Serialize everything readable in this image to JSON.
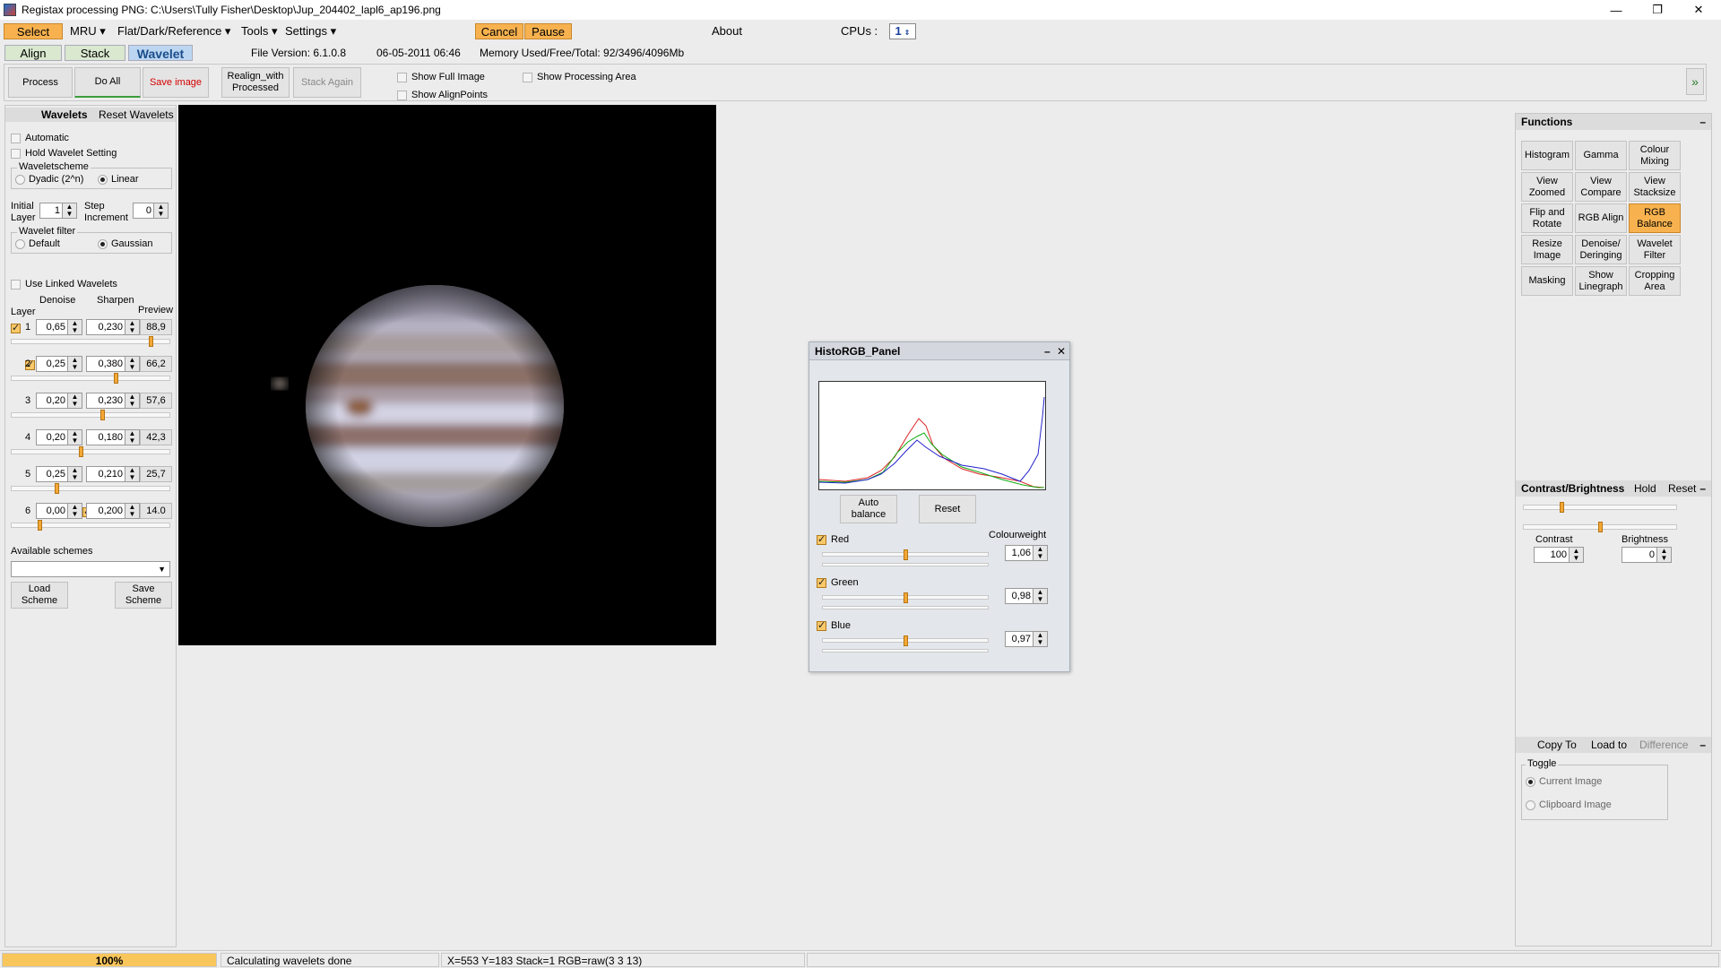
{
  "window": {
    "title": "Registax processing PNG: C:\\Users\\Tully Fisher\\Desktop\\Jup_204402_lapl6_ap196.png",
    "minimize": "—",
    "maximize": "❐",
    "close": "✕"
  },
  "menu": {
    "select": "Select",
    "mru": "MRU ▾",
    "flat": "Flat/Dark/Reference ▾",
    "tools": "Tools ▾",
    "settings": "Settings ▾",
    "cancel": "Cancel",
    "pause": "Pause",
    "about": "About",
    "cpus_label": "CPUs :",
    "cpus_value": "1"
  },
  "tabs": {
    "align": "Align",
    "stack": "Stack",
    "wavelet": "Wavelet"
  },
  "info": {
    "file_version": "File Version: 6.1.0.8",
    "date": "06-05-2011 06:46",
    "memory": "Memory Used/Free/Total: 92/3496/4096Mb"
  },
  "toolbar": {
    "process": "Process",
    "do_all": "Do All",
    "save_image": "Save image",
    "realign": "Realign_with Processed",
    "stack_again": "Stack Again",
    "show_full_image": "Show Full Image",
    "show_alignpoints": "Show AlignPoints",
    "show_processing_area": "Show Processing Area",
    "expand": "»"
  },
  "wavelets": {
    "title": "Wavelets",
    "reset": "Reset Wavelets",
    "automatic": "Automatic",
    "hold": "Hold Wavelet Setting",
    "scheme_group": "Waveletscheme",
    "dyadic": "Dyadic (2^n)",
    "linear": "Linear",
    "initial_layer_l1": "Initial",
    "initial_layer_l2": "Layer",
    "initial_layer_value": "1",
    "step_l1": "Step",
    "step_l2": "Increment",
    "step_value": "0",
    "filter_group": "Wavelet filter",
    "default": "Default",
    "gaussian": "Gaussian",
    "use_linked": "Use Linked Wavelets",
    "col_denoise": "Denoise",
    "col_sharpen": "Sharpen",
    "col_layer": "Layer",
    "col_preview": "Preview",
    "layers": [
      {
        "n": "1",
        "denoise": "0,65",
        "sharpen": "0,230",
        "preview": "88,9",
        "level": 0.9
      },
      {
        "n": "2",
        "denoise": "0,25",
        "sharpen": "0,380",
        "preview": "66,2",
        "level": 0.67
      },
      {
        "n": "3",
        "denoise": "0,20",
        "sharpen": "0,230",
        "preview": "57,6",
        "level": 0.58
      },
      {
        "n": "4",
        "denoise": "0,20",
        "sharpen": "0,180",
        "preview": "42,3",
        "level": 0.44
      },
      {
        "n": "5",
        "denoise": "0,25",
        "sharpen": "0,210",
        "preview": "25,7",
        "level": 0.28
      },
      {
        "n": "6",
        "denoise": "0,00",
        "sharpen": "0,200",
        "preview": "14.0",
        "level": 0.17
      }
    ],
    "available_schemes": "Available schemes",
    "load_scheme": "Load Scheme",
    "save_scheme": "Save Scheme"
  },
  "functions": {
    "title": "Functions",
    "collapse": "–",
    "buttons": [
      "Histogram",
      "Gamma",
      "Colour Mixing",
      "View Zoomed",
      "View Compare",
      "View Stacksize",
      "Flip and Rotate",
      "RGB Align",
      "RGB Balance",
      "Resize Image",
      "Denoise/ Deringing",
      "Wavelet Filter",
      "Masking",
      "Show Linegraph",
      "Cropping Area"
    ]
  },
  "contrast": {
    "title": "Contrast/Brightness",
    "hold": "Hold",
    "reset": "Reset",
    "collapse": "–",
    "contrast_label": "Contrast",
    "contrast_value": "100",
    "brightness_label": "Brightness",
    "brightness_value": "0",
    "contrast_level": 0.24,
    "brightness_level": 0.5
  },
  "copy": {
    "copy_to": "Copy To",
    "load_to": "Load to",
    "difference": "Difference",
    "collapse": "–",
    "toggle": "Toggle",
    "current_image": "Current Image",
    "clipboard_image": "Clipboard Image"
  },
  "histo": {
    "title": "HistoRGB_Panel",
    "min": "–",
    "close": "✕",
    "auto_balance": "Auto balance",
    "reset": "Reset",
    "colourweight": "Colourweight",
    "channels": [
      {
        "name": "Red",
        "value": "1,06",
        "level": 0.5
      },
      {
        "name": "Green",
        "value": "0,98",
        "level": 0.5
      },
      {
        "name": "Blue",
        "value": "0,97",
        "level": 0.5
      }
    ]
  },
  "status": {
    "zoom": "100%",
    "message": "Calculating wavelets done",
    "coords": "X=553 Y=183 Stack=1 RGB=raw(3 3 13)"
  },
  "colors": {
    "accent_orange": "#f7b24f",
    "tab_active": "#bcd6f2",
    "red_text": "#d40000"
  }
}
